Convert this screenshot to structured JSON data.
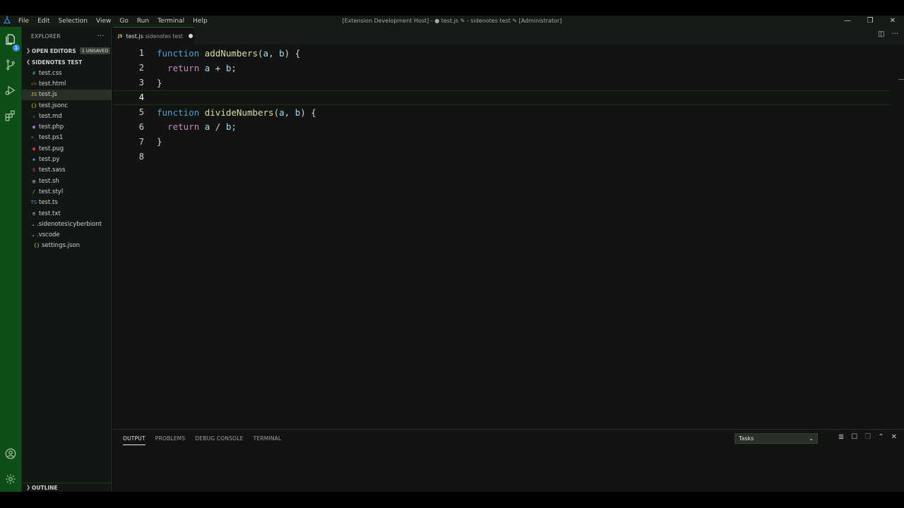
{
  "titlebar": {
    "menu": [
      "File",
      "Edit",
      "Selection",
      "View",
      "Go",
      "Run",
      "Terminal",
      "Help"
    ],
    "window_title": "[Extension Development Host] - ● test.js ✎ - sidenotes test ✎ [Administrator]",
    "controls": {
      "minimize": "—",
      "restore": "❐",
      "close": "✕"
    }
  },
  "activitybar": {
    "icons": [
      "explorer-icon",
      "source-control-icon",
      "run-debug-icon",
      "extensions-icon",
      "accounts-icon",
      "settings-gear-icon"
    ],
    "explorer_badge": "1"
  },
  "sidebar": {
    "title": "EXPLORER",
    "more": "···",
    "open_editors": {
      "label": "OPEN EDITORS",
      "badge": "1 UNSAVED"
    },
    "folder": "SIDENOTES TEST",
    "files": [
      {
        "icon": "#",
        "name": "test.css",
        "color": "#519aba"
      },
      {
        "icon": "<>",
        "name": "test.html",
        "color": "#e44d26"
      },
      {
        "icon": "JS",
        "name": "test.js",
        "color": "#cbcb41",
        "active": true
      },
      {
        "icon": "{}",
        "name": "test.jsonc",
        "color": "#cbcb41"
      },
      {
        "icon": "↓",
        "name": "test.md",
        "color": "#519aba"
      },
      {
        "icon": "●",
        "name": "test.php",
        "color": "#a074c4"
      },
      {
        "icon": ">_",
        "name": "test.ps1",
        "color": "#519aba"
      },
      {
        "icon": "●",
        "name": "test.pug",
        "color": "#cc3e44"
      },
      {
        "icon": "◆",
        "name": "test.py",
        "color": "#3c9ad6"
      },
      {
        "icon": "♀",
        "name": "test.sass",
        "color": "#f55385"
      },
      {
        "icon": "▣",
        "name": "test.sh",
        "color": "#8a8a8a"
      },
      {
        "icon": "/",
        "name": "test.styl",
        "color": "#8dc149"
      },
      {
        "icon": "TS",
        "name": "test.ts",
        "color": "#519aba"
      },
      {
        "icon": "≡",
        "name": "test.txt",
        "color": "#c0c0c0"
      }
    ],
    "folders": [
      ".sidenotes\\cyberbiont",
      ".vscode"
    ],
    "nested_file": {
      "icon": "{}",
      "name": "settings.json",
      "color": "#cbcb41"
    },
    "outline": "OUTLINE"
  },
  "editor": {
    "tab": {
      "icon": "JS",
      "name": "test.js",
      "description": "sidenotes test"
    },
    "actions": {
      "split": "◫",
      "more": "···"
    },
    "lines": [
      "1",
      "2",
      "3",
      "4",
      "5",
      "6",
      "7",
      "8"
    ]
  },
  "panel": {
    "tabs": [
      "OUTPUT",
      "PROBLEMS",
      "DEBUG CONSOLE",
      "TERMINAL"
    ],
    "select_value": "Tasks",
    "actions": {
      "clear": "≣",
      "lock": "☐",
      "copy": "❐",
      "maximize": "⌃",
      "close": "✕"
    }
  },
  "colors": {
    "activitybar_bg": "#0f4d19",
    "sidebar_bg": "#131713",
    "editor_bg": "#111411",
    "keyword": "#569cd6",
    "function": "#dcdcaa",
    "parameter": "#9cdcfe",
    "control": "#c586c0"
  }
}
